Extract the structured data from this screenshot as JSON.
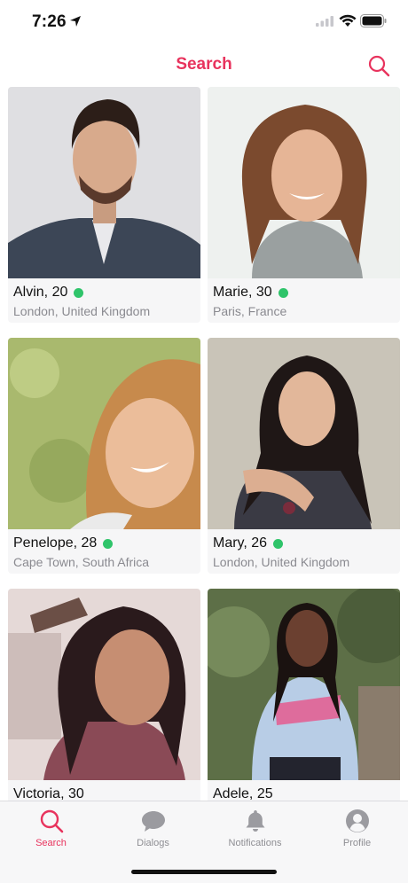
{
  "status": {
    "time": "7:26"
  },
  "header": {
    "title": "Search"
  },
  "profiles": [
    {
      "name": "Alvin, 20",
      "location": "London, United Kingdom",
      "online": true
    },
    {
      "name": "Marie, 30",
      "location": "Paris, France",
      "online": true
    },
    {
      "name": "Penelope, 28",
      "location": "Cape Town, South Africa",
      "online": true
    },
    {
      "name": "Mary, 26",
      "location": "London, United Kingdom",
      "online": true
    },
    {
      "name": "Victoria, 30",
      "location": "",
      "online": false
    },
    {
      "name": "Adele, 25",
      "location": "",
      "online": false
    }
  ],
  "tabs": [
    {
      "label": "Search",
      "icon": "search-icon",
      "active": true
    },
    {
      "label": "Dialogs",
      "icon": "chat-bubble-icon",
      "active": false
    },
    {
      "label": "Notifications",
      "icon": "bell-icon",
      "active": false
    },
    {
      "label": "Profile",
      "icon": "person-icon",
      "active": false
    }
  ],
  "colors": {
    "accent": "#e8335d",
    "online": "#2fc46a",
    "inactive_tab": "#8e8e93"
  }
}
